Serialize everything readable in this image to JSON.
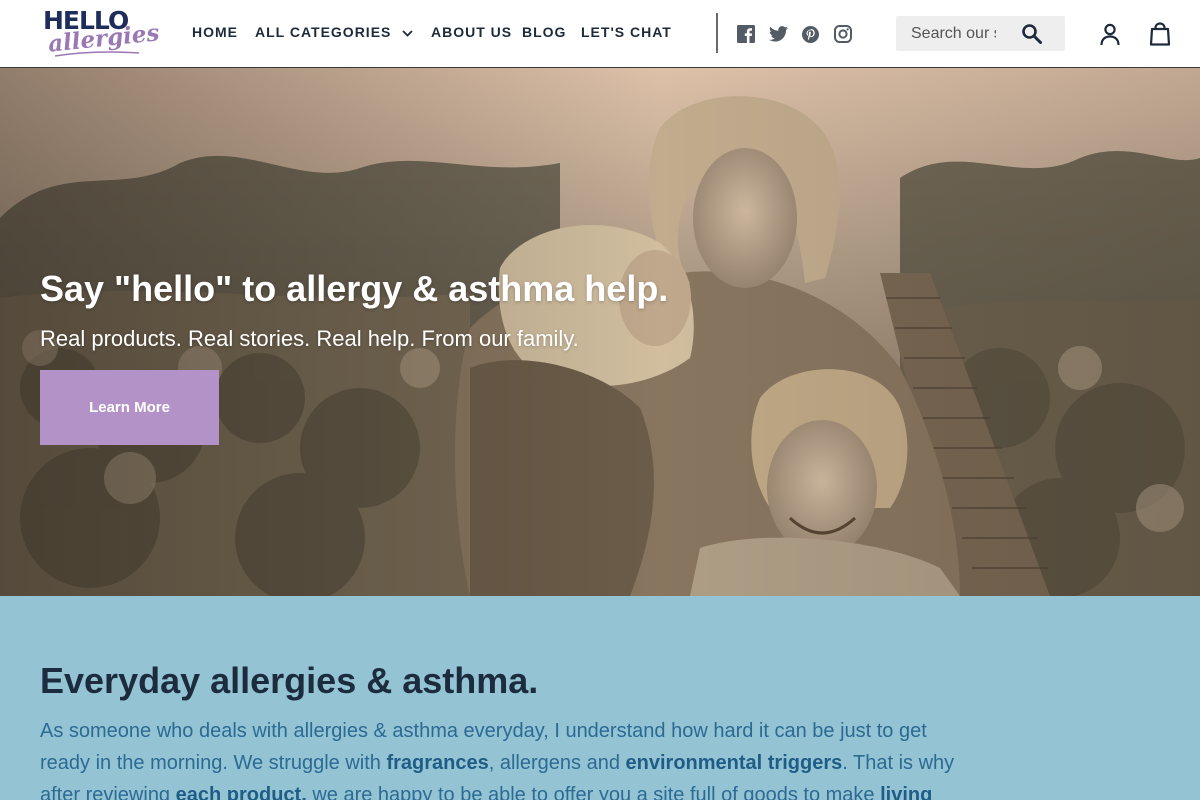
{
  "brand": {
    "logo_top": "HELLO",
    "logo_bottom": "allergies"
  },
  "nav": {
    "items": [
      {
        "label": "HOME"
      },
      {
        "label": "ALL CATEGORIES"
      },
      {
        "label": "ABOUT US"
      },
      {
        "label": "BLOG"
      },
      {
        "label": "LET'S CHAT"
      }
    ]
  },
  "social": [
    "facebook-icon",
    "twitter-icon",
    "pinterest-icon",
    "instagram-icon"
  ],
  "search": {
    "placeholder": "Search our store"
  },
  "hero": {
    "title": "Say \"hello\" to allergy & asthma help.",
    "subtitle": "Real products. Real stories. Real help. From our family.",
    "button_label": "Learn More"
  },
  "info": {
    "title": "Everyday allergies & asthma.",
    "p1": "As someone who deals with allergies & asthma everyday, I understand how hard it can be just to get ready in the morning. We struggle with ",
    "b1": "fragrances",
    "p2": ", allergens and ",
    "b2": "environmental triggers",
    "p3": ". That is why after reviewing ",
    "b3": "each product,",
    "p4": " we are happy to be able to offer you a site full of goods to make ",
    "b4": "living"
  },
  "colors": {
    "brand_navy": "#1f2d5c",
    "brand_purple": "#9a78b4",
    "button_purple": "#b393c7",
    "info_bg": "#94c4d4",
    "info_text": "#2b6a93"
  }
}
